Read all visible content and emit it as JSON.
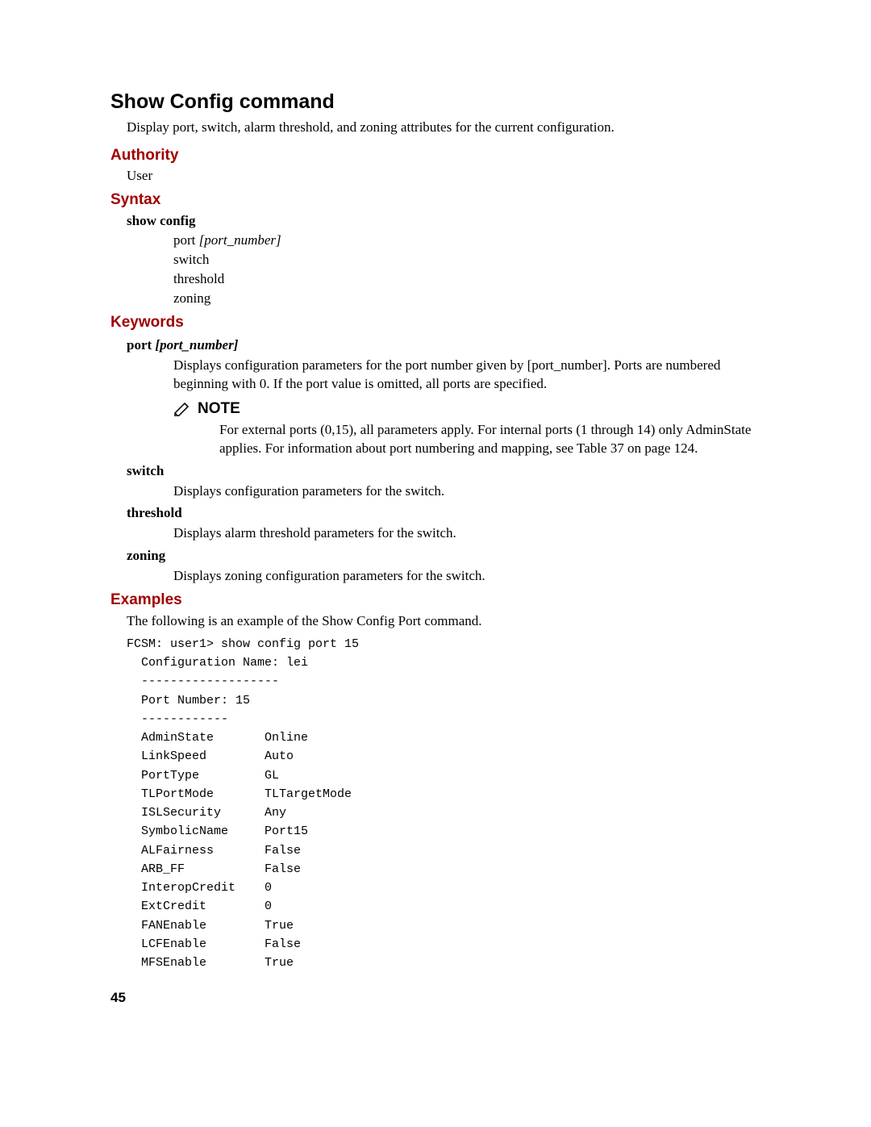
{
  "title": "Show Config command",
  "lead": "Display port, switch, alarm threshold, and zoning attributes for the current configuration.",
  "sections": {
    "authority": {
      "label": "Authority",
      "value": "User"
    },
    "syntax": {
      "label": "Syntax",
      "cmd": "show config",
      "args": {
        "port_prefix": "port ",
        "port_param": "[port_number]",
        "switch": "switch",
        "threshold": "threshold",
        "zoning": "zoning"
      }
    },
    "keywords": {
      "label": "Keywords",
      "port": {
        "term_prefix": "port ",
        "term_param": "[port_number]",
        "body": "Displays configuration parameters for the port number given by [port_number]. Ports are numbered beginning with 0. If the port value is omitted, all ports are specified.",
        "note_label": "NOTE",
        "note_body": "For external ports (0,15), all parameters apply. For internal ports (1 through 14) only AdminState applies. For information about port numbering and mapping, see Table 37 on page 124."
      },
      "switch": {
        "term": "switch",
        "body": "Displays configuration parameters for the switch."
      },
      "threshold": {
        "term": "threshold",
        "body": "Displays alarm threshold parameters for the switch."
      },
      "zoning": {
        "term": "zoning",
        "body": "Displays zoning configuration parameters for the switch."
      }
    },
    "examples": {
      "label": "Examples",
      "intro": "The following is an example of the Show Config Port command.",
      "code": "FCSM: user1> show config port 15\n  Configuration Name: lei\n  -------------------\n  Port Number: 15\n  ------------\n  AdminState       Online\n  LinkSpeed        Auto\n  PortType         GL\n  TLPortMode       TLTargetMode\n  ISLSecurity      Any\n  SymbolicName     Port15\n  ALFairness       False\n  ARB_FF           False\n  InteropCredit    0\n  ExtCredit        0\n  FANEnable        True\n  LCFEnable        False\n  MFSEnable        True"
    }
  },
  "page_number": "45"
}
